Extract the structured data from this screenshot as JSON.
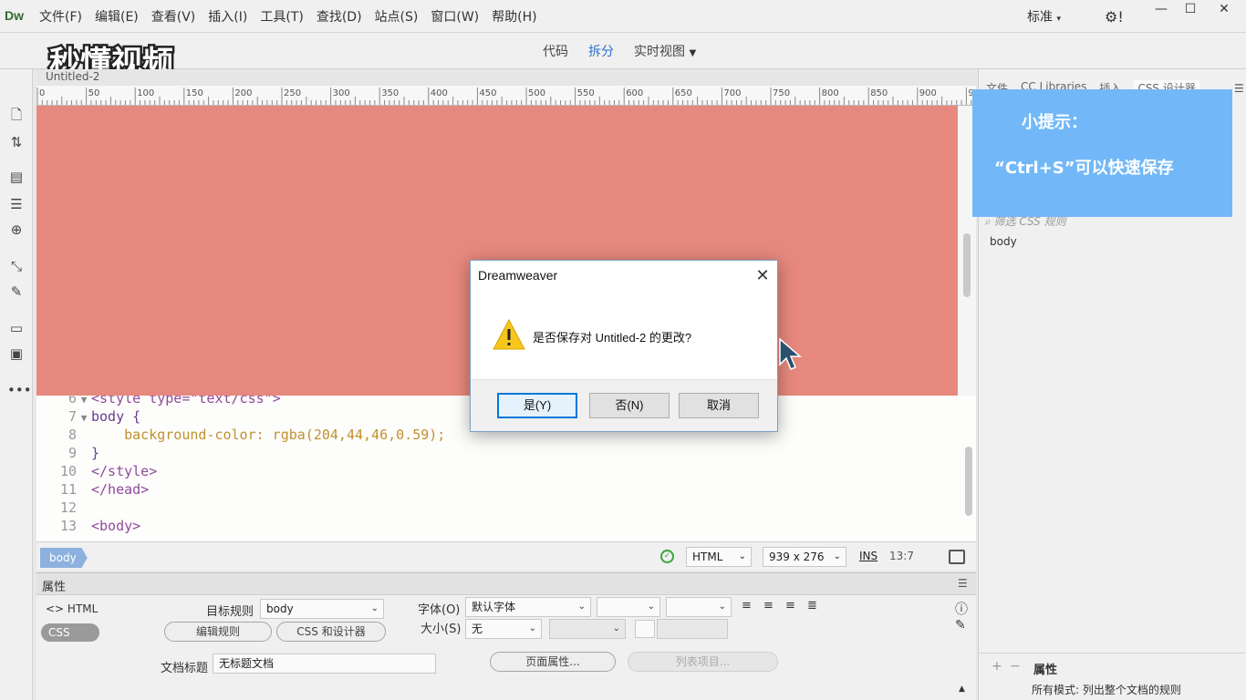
{
  "app": {
    "logo": "Dw",
    "menu": [
      "文件(F)",
      "编辑(E)",
      "查看(V)",
      "插入(I)",
      "工具(T)",
      "查找(D)",
      "站点(S)",
      "窗口(W)",
      "帮助(H)"
    ],
    "layout_label": "标准",
    "gear_label": "⚙!"
  },
  "view_switch": {
    "code": "代码",
    "split": "拆分",
    "live": "实时视图",
    "active": "split"
  },
  "watermark_text": "秒懂视频",
  "document": {
    "tab_title": "Untitled-2",
    "ruler_ticks": [
      "0",
      "50",
      "100",
      "150",
      "200",
      "250",
      "300",
      "350",
      "400",
      "450",
      "500",
      "550",
      "600",
      "650",
      "700",
      "750",
      "800",
      "850",
      "900",
      "9"
    ],
    "live_bg_color": "#e6887d"
  },
  "code": {
    "lines": [
      {
        "num": "6",
        "fold": "▼",
        "text": "<style type=\"text/css\">"
      },
      {
        "num": "7",
        "fold": "▼",
        "text": "body {"
      },
      {
        "num": "8",
        "fold": "",
        "text": "    background-color: rgba(204,44,46,0.59);"
      },
      {
        "num": "9",
        "fold": "",
        "text": "}"
      },
      {
        "num": "10",
        "fold": "",
        "text": "</style>"
      },
      {
        "num": "11",
        "fold": "",
        "text": "</head>"
      },
      {
        "num": "12",
        "fold": "",
        "text": ""
      },
      {
        "num": "13",
        "fold": "",
        "text": "<body>"
      }
    ]
  },
  "statusbar": {
    "tag": "body",
    "doc_type": "HTML",
    "window_size": "939 x 276",
    "ins": "INS",
    "cursor_pos": "13:7"
  },
  "properties": {
    "title": "属性",
    "mode_html": "<> HTML",
    "mode_css": "CSS",
    "target_rule_label": "目标规则",
    "target_rule_value": "body",
    "edit_rule_btn": "编辑规则",
    "css_designer_btn": "CSS 和设计器",
    "font_label": "字体(O)",
    "font_value": "默认字体",
    "size_label": "大小(S)",
    "size_value": "无",
    "doc_title_label": "文档标题",
    "doc_title_value": "无标题文档",
    "page_props_btn": "页面属性...",
    "list_item_btn": "列表项目..."
  },
  "right_panel": {
    "tabs": [
      "文件",
      "CC Libraries",
      "插入",
      "CSS 设计器"
    ],
    "active_tab": "CSS 设计器",
    "search_placeholder": "筛选 CSS 规则",
    "rule_item": "body",
    "props_label": "属性",
    "mode_text": "所有模式: 列出整个文档的规则"
  },
  "tip": {
    "title": "小提示：",
    "text": "“Ctrl+S”可以快速保存"
  },
  "dialog": {
    "title": "Dreamweaver",
    "message": "是否保存对 Untitled-2 的更改?",
    "yes": "是(Y)",
    "no": "否(N)",
    "cancel": "取消"
  }
}
